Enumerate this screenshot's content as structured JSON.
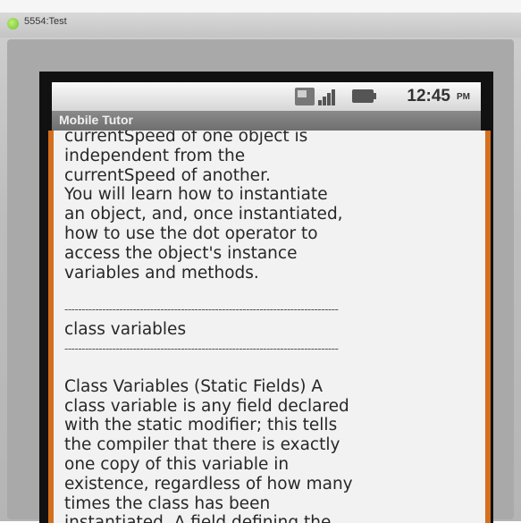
{
  "emulator": {
    "title": "5554:Test"
  },
  "status_bar": {
    "time": "12:45",
    "ampm": "PM",
    "icons": [
      "3g-icon",
      "signal-icon",
      "battery-icon"
    ]
  },
  "app": {
    "title": "Mobile Tutor"
  },
  "content": {
    "lines": [
      "currentSpeed of one object is",
      "independent from the",
      "currentSpeed of another.",
      " You will learn how to instantiate",
      "an object, and, once instantiated,",
      "how to use the dot operator to",
      "access the object's instance",
      "variables and methods."
    ],
    "divider_top": "--------------------------------------------------------------------------------",
    "section_title": "class variables",
    "divider_bottom": "--------------------------------------------------------------------------------",
    "body_lines": [
      "Class Variables (Static Fields) A",
      "class variable is any field declared",
      "with the static modifier; this tells",
      "the compiler that there is exactly",
      "one copy of this variable in",
      "existence, regardless of how many",
      "times the class has been",
      "instantiated. A field defining the"
    ]
  },
  "colors": {
    "frame_accent": "#d46f1d",
    "content_background": "#f2f2f2",
    "app_titlebar": "#7a7a7a"
  }
}
